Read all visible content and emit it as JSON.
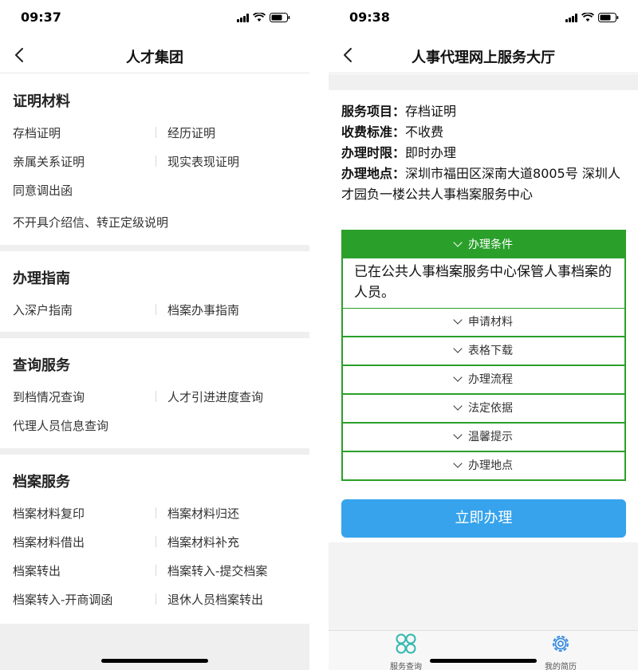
{
  "left": {
    "status": {
      "time": "09:37"
    },
    "nav": {
      "title": "人才集团"
    },
    "sections": {
      "cert": {
        "title": "证明材料",
        "items": [
          "存档证明",
          "经历证明",
          "亲属关系证明",
          "现实表现证明",
          "同意调出函",
          "不开具介绍信、转正定级说明"
        ]
      },
      "guide": {
        "title": "办理指南",
        "items": [
          "入深户指南",
          "档案办事指南"
        ]
      },
      "query": {
        "title": "查询服务",
        "items": [
          "到档情况查询",
          "人才引进进度查询",
          "代理人员信息查询"
        ]
      },
      "archive": {
        "title": "档案服务",
        "items": [
          "档案材料复印",
          "档案材料归还",
          "档案材料借出",
          "档案材料补充",
          "档案转出",
          "档案转入-提交档案",
          "档案转入-开商调函",
          "退休人员档案转出"
        ]
      }
    }
  },
  "right": {
    "status": {
      "time": "09:38"
    },
    "nav": {
      "title": "人事代理网上服务大厅"
    },
    "info": {
      "service_label": "服务项目：",
      "service_value": "存档证明",
      "fee_label": "收费标准：",
      "fee_value": "不收费",
      "time_label": "办理时限：",
      "time_value": "即时办理",
      "place_label": "办理地点：",
      "place_value": "深圳市福田区深南大道8005号 深圳人才园负一楼公共人事档案服务中心"
    },
    "accordion": {
      "open_title": "办理条件",
      "open_body": "已在公共人事档案服务中心保管人事档案的人员。",
      "rows": [
        "申请材料",
        "表格下载",
        "办理流程",
        "法定依据",
        "温馨提示",
        "办理地点"
      ]
    },
    "submit_label": "立即办理",
    "tabbar": {
      "tabs": [
        {
          "label": "服务查询",
          "icon": "grid-icon"
        },
        {
          "label": "我的简历",
          "icon": "gear-icon"
        }
      ]
    }
  },
  "colors": {
    "accent_green": "#2aa02a",
    "button_blue": "#36a3ec",
    "tab_teal": "#34b8b0",
    "tab_blue": "#3a8ee6"
  }
}
